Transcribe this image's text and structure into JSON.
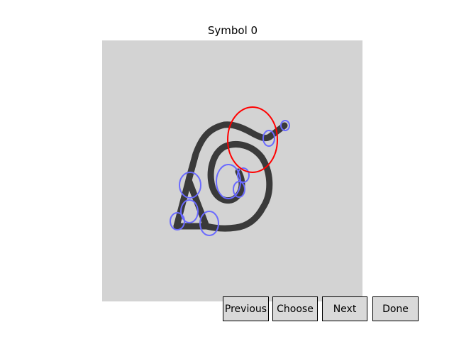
{
  "title": "Symbol 0",
  "buttons": {
    "previous": "Previous",
    "choose": "Choose",
    "next": "Next",
    "done": "Done"
  },
  "colors": {
    "stroke": "#3a3a3a",
    "highlight": "#ff0000",
    "candidate": "#6a6aff",
    "canvas_bg": "#d3d3d3"
  }
}
